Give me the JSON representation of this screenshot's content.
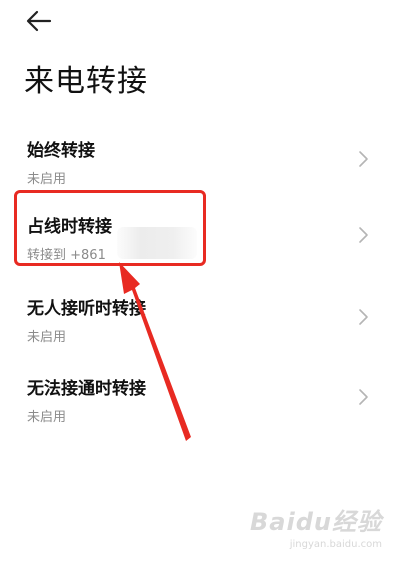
{
  "header": {
    "back_icon": "arrow-left-icon",
    "title": "来电转接"
  },
  "forwarding_options": [
    {
      "label": "始终转接",
      "status": "未启用"
    },
    {
      "label": "占线时转接",
      "status": "转接到 +861"
    },
    {
      "label": "无人接听时转接",
      "status": "未启用"
    },
    {
      "label": "无法接通时转接",
      "status": "未启用"
    }
  ],
  "icons": {
    "row_chevron": "chevron-right-icon"
  },
  "annotation": {
    "highlight_color": "#e82a22",
    "highlighted_option": "占线时转接"
  },
  "watermark": {
    "logo": "Baidu经验",
    "sub": "jingyan.baidu.com"
  }
}
